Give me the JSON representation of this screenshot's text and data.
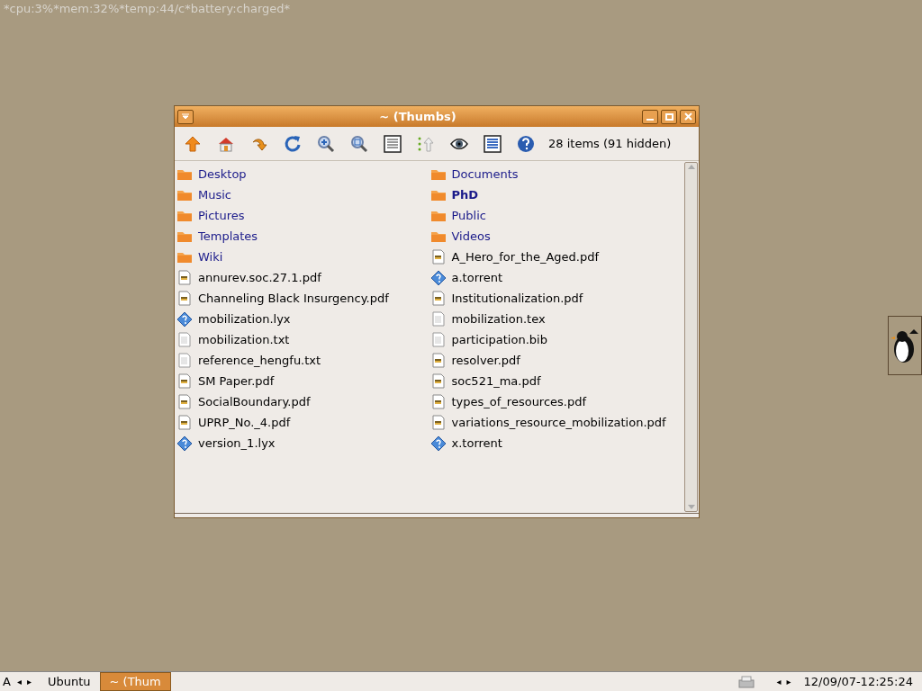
{
  "status_line": "*cpu:3%*mem:32%*temp:44/c*battery:charged*",
  "window": {
    "title": "~ (Thumbs)"
  },
  "toolbar": {
    "buttons": [
      {
        "kind": "up"
      },
      {
        "kind": "home"
      },
      {
        "kind": "forward"
      },
      {
        "kind": "refresh"
      },
      {
        "kind": "zoom_in"
      },
      {
        "kind": "zoom_fit"
      },
      {
        "kind": "list"
      },
      {
        "kind": "hidden"
      },
      {
        "kind": "eye"
      },
      {
        "kind": "details"
      },
      {
        "kind": "help"
      }
    ],
    "item_count": "28 items (91 hidden)"
  },
  "files": [
    {
      "name": "Desktop",
      "kind": "folder",
      "emphasized": false
    },
    {
      "name": "Documents",
      "kind": "folder",
      "emphasized": false
    },
    {
      "name": "Music",
      "kind": "folder",
      "emphasized": false
    },
    {
      "name": "PhD",
      "kind": "folder",
      "emphasized": true
    },
    {
      "name": "Pictures",
      "kind": "folder",
      "emphasized": false
    },
    {
      "name": "Public",
      "kind": "folder",
      "emphasized": false
    },
    {
      "name": "Templates",
      "kind": "folder",
      "emphasized": false
    },
    {
      "name": "Videos",
      "kind": "folder",
      "emphasized": false
    },
    {
      "name": "Wiki",
      "kind": "folder",
      "emphasized": false
    },
    {
      "name": "A_Hero_for_the_Aged.pdf",
      "kind": "pdf",
      "emphasized": false
    },
    {
      "name": "annurev.soc.27.1.pdf",
      "kind": "pdf",
      "emphasized": false
    },
    {
      "name": "a.torrent",
      "kind": "unknown",
      "emphasized": false
    },
    {
      "name": "Channeling Black Insurgency.pdf",
      "kind": "pdf",
      "emphasized": false
    },
    {
      "name": "Institutionalization.pdf",
      "kind": "pdf",
      "emphasized": false
    },
    {
      "name": "mobilization.lyx",
      "kind": "unknown",
      "emphasized": false
    },
    {
      "name": "mobilization.tex",
      "kind": "text",
      "emphasized": false
    },
    {
      "name": "mobilization.txt",
      "kind": "text",
      "emphasized": false
    },
    {
      "name": "participation.bib",
      "kind": "text",
      "emphasized": false
    },
    {
      "name": "reference_hengfu.txt",
      "kind": "text",
      "emphasized": false
    },
    {
      "name": "resolver.pdf",
      "kind": "pdf",
      "emphasized": false
    },
    {
      "name": "SM Paper.pdf",
      "kind": "pdf",
      "emphasized": false
    },
    {
      "name": "soc521_ma.pdf",
      "kind": "pdf",
      "emphasized": false
    },
    {
      "name": "SocialBoundary.pdf",
      "kind": "pdf",
      "emphasized": false
    },
    {
      "name": "types_of_resources.pdf",
      "kind": "pdf",
      "emphasized": false
    },
    {
      "name": "UPRP_No._4.pdf",
      "kind": "pdf",
      "emphasized": false
    },
    {
      "name": "variations_resource_mobilization.pdf",
      "kind": "pdf",
      "emphasized": false
    },
    {
      "name": "version_1.lyx",
      "kind": "unknown",
      "emphasized": false
    },
    {
      "name": "x.torrent",
      "kind": "unknown",
      "emphasized": false
    }
  ],
  "taskbar": {
    "start": "A",
    "left_arrows": [
      "◂",
      "▸"
    ],
    "tasks": [
      {
        "label": "Ubuntu",
        "selected": false
      },
      {
        "label": "~ (Thum",
        "selected": true
      }
    ],
    "right_arrows": [
      "◂",
      "▸"
    ],
    "clock": "12/09/07-12:25:24"
  }
}
